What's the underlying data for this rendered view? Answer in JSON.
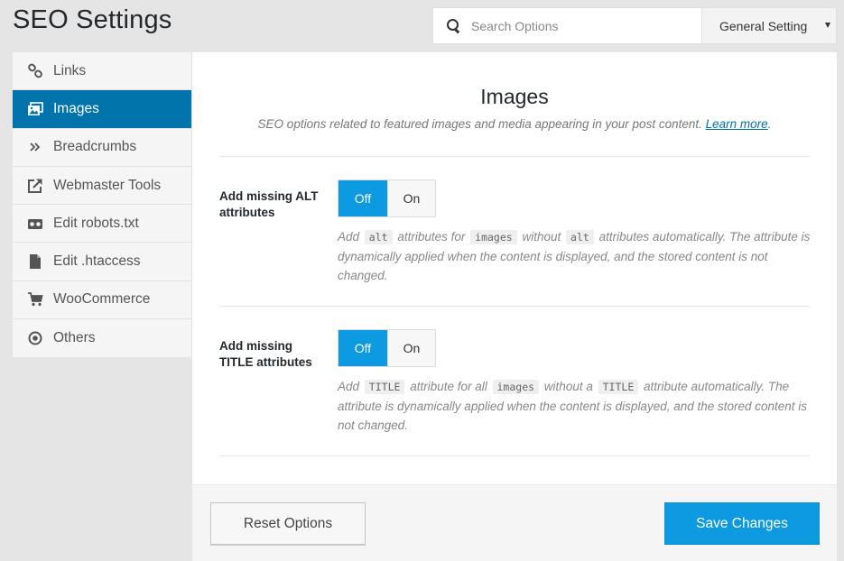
{
  "header": {
    "title": "SEO Settings",
    "search": {
      "placeholder": "Search Options",
      "value": ""
    },
    "select": {
      "value": "General Setting"
    }
  },
  "sidebar": {
    "items": [
      {
        "label": "Links",
        "icon": "link-icon",
        "active": false
      },
      {
        "label": "Images",
        "icon": "images-icon",
        "active": true
      },
      {
        "label": "Breadcrumbs",
        "icon": "chevrons-right-icon",
        "active": false
      },
      {
        "label": "Webmaster Tools",
        "icon": "external-link-icon",
        "active": false
      },
      {
        "label": "Edit robots.txt",
        "icon": "robot-icon",
        "active": false
      },
      {
        "label": "Edit .htaccess",
        "icon": "file-icon",
        "active": false
      },
      {
        "label": "WooCommerce",
        "icon": "cart-icon",
        "active": false
      },
      {
        "label": "Others",
        "icon": "radio-circle-icon",
        "active": false
      }
    ]
  },
  "main": {
    "title": "Images",
    "description": "SEO options related to featured images and media appearing in your post content.",
    "learn_more": "Learn more",
    "fields": [
      {
        "label": "Add missing ALT attributes",
        "off_label": "Off",
        "on_label": "On",
        "value": "Off",
        "desc": {
          "t1": "Add",
          "c1": "alt",
          "t2": "attributes for",
          "c2": "images",
          "t3": "without",
          "c3": "alt",
          "t4": "attributes automatically. The attribute is dynamically applied when the content is displayed, and the stored content is not changed."
        }
      },
      {
        "label": "Add missing TITLE attributes",
        "off_label": "Off",
        "on_label": "On",
        "value": "Off",
        "desc": {
          "t1": "Add",
          "c1": "TITLE",
          "t2": "attribute for all",
          "c2": "images",
          "t3": "without a",
          "c3": "TITLE",
          "t4": "attribute automatically. The attribute is dynamically applied when the content is displayed, and the stored content is not changed."
        }
      }
    ]
  },
  "footer": {
    "reset_label": "Reset Options",
    "save_label": "Save Changes"
  },
  "colors": {
    "accent": "#0073aa",
    "toggle_active": "#0d9ae0",
    "button_primary": "#0d9ae0"
  }
}
